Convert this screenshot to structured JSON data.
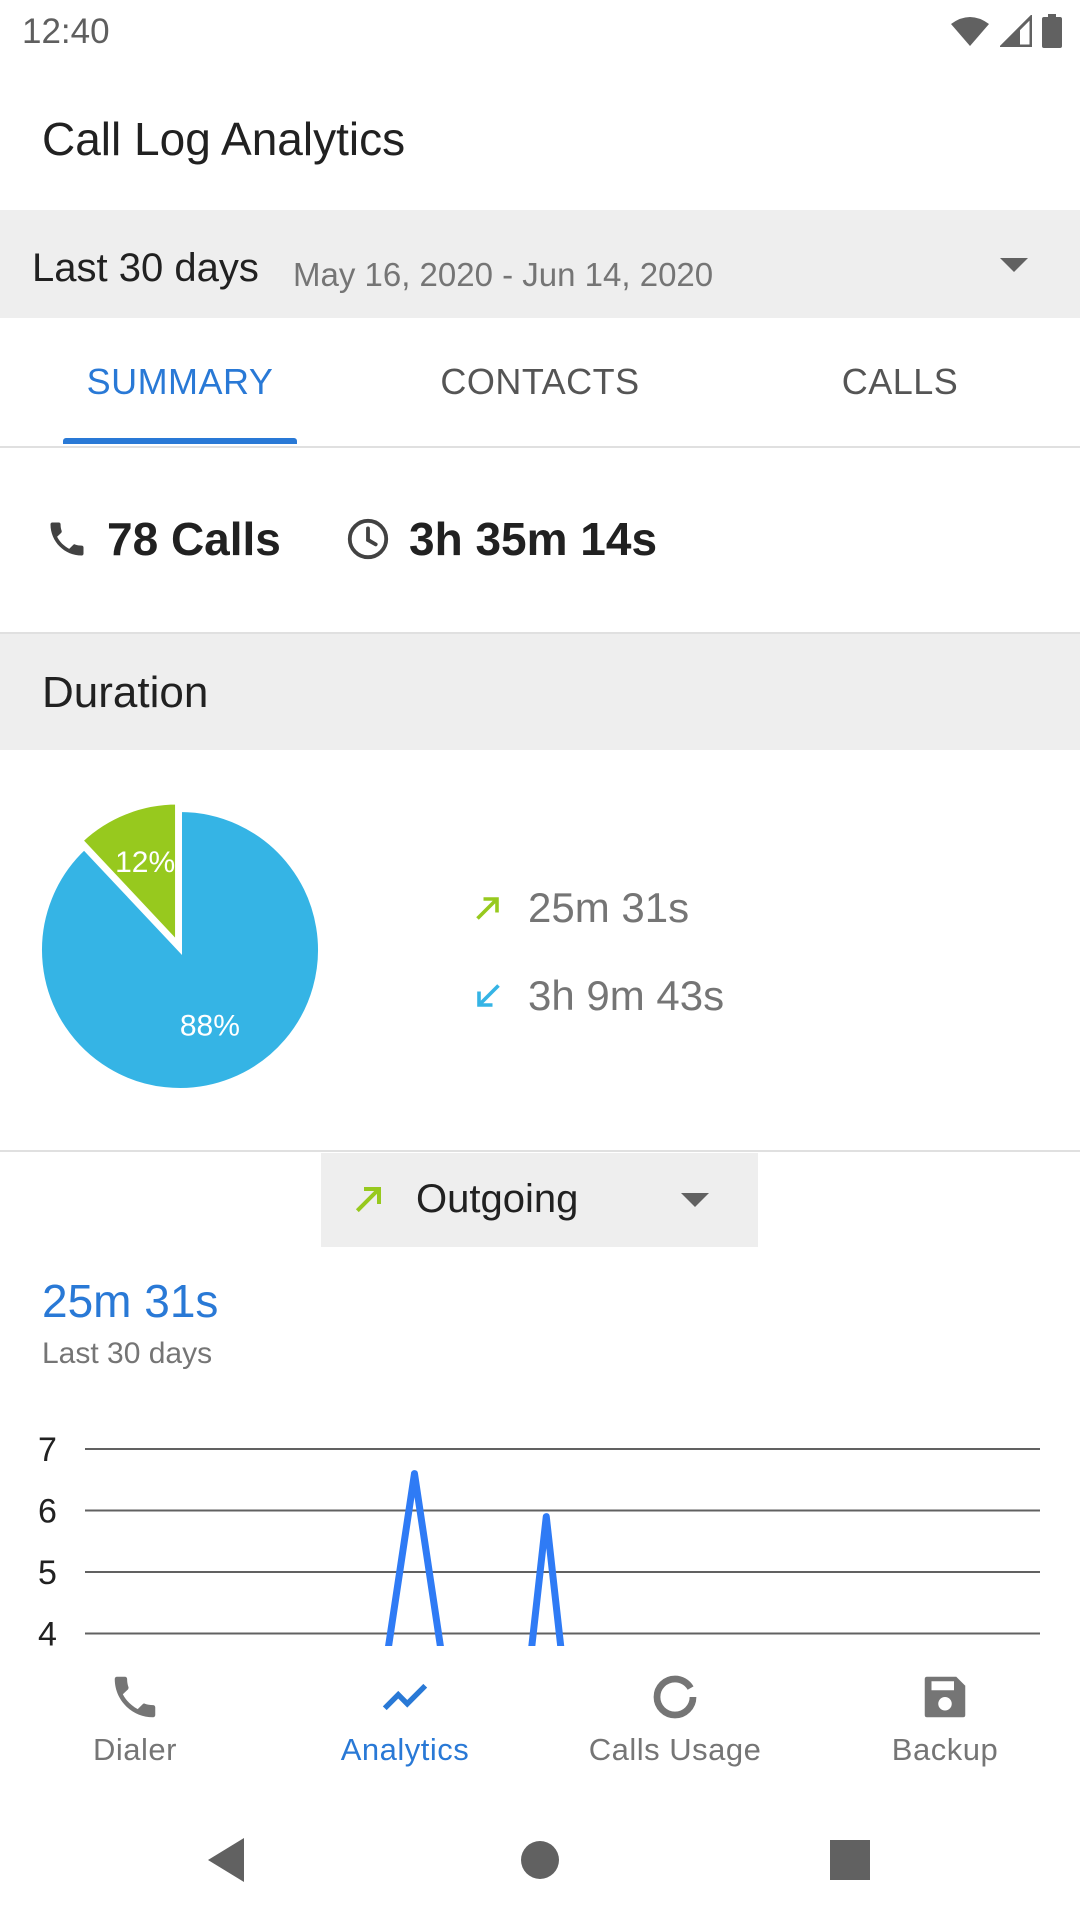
{
  "status_bar": {
    "time": "12:40"
  },
  "app_bar": {
    "title": "Call Log Analytics"
  },
  "range": {
    "label": "Last 30 days",
    "dates": "May 16, 2020 - Jun 14, 2020"
  },
  "tabs": [
    {
      "label": "SUMMARY",
      "active": true
    },
    {
      "label": "CONTACTS",
      "active": false
    },
    {
      "label": "CALLS",
      "active": false
    }
  ],
  "stats": {
    "calls": "78 Calls",
    "duration": "3h 35m 14s"
  },
  "duration_section": {
    "title": "Duration",
    "pie": {
      "slices": [
        {
          "name": "outgoing",
          "percent": 12,
          "label": "12%",
          "color": "#97c91e"
        },
        {
          "name": "incoming",
          "percent": 88,
          "label": "88%",
          "color": "#35b4e5"
        }
      ]
    },
    "legend": [
      {
        "direction": "outgoing",
        "icon": "arrow-up-right-icon",
        "value": "25m 31s",
        "color": "#97c91e"
      },
      {
        "direction": "incoming",
        "icon": "arrow-down-left-icon",
        "value": "3h 9m 43s",
        "color": "#35b4e5"
      }
    ]
  },
  "direction_select": {
    "selected": "Outgoing",
    "icon": "arrow-up-right-icon"
  },
  "chart_header": {
    "total": "25m 31s",
    "subtitle": "Last 30 days"
  },
  "chart_data": {
    "type": "line",
    "title": "",
    "xlabel": "",
    "ylabel": "",
    "y_ticks": [
      "7",
      "6",
      "5",
      "4"
    ],
    "grid": true,
    "color": "#2f7bf5",
    "visible_peaks": [
      {
        "x_fraction": 0.345,
        "y": 6.6
      },
      {
        "x_fraction": 0.483,
        "y": 5.9
      }
    ]
  },
  "bottom_nav": [
    {
      "label": "Dialer",
      "icon": "phone-icon",
      "active": false
    },
    {
      "label": "Analytics",
      "icon": "trending-up-icon",
      "active": true
    },
    {
      "label": "Calls Usage",
      "icon": "donut-icon",
      "active": false
    },
    {
      "label": "Backup",
      "icon": "floppy-disk-icon",
      "active": false
    }
  ],
  "colors": {
    "accent": "#2979d6",
    "outgoing": "#97c91e",
    "incoming": "#35b4e5"
  }
}
